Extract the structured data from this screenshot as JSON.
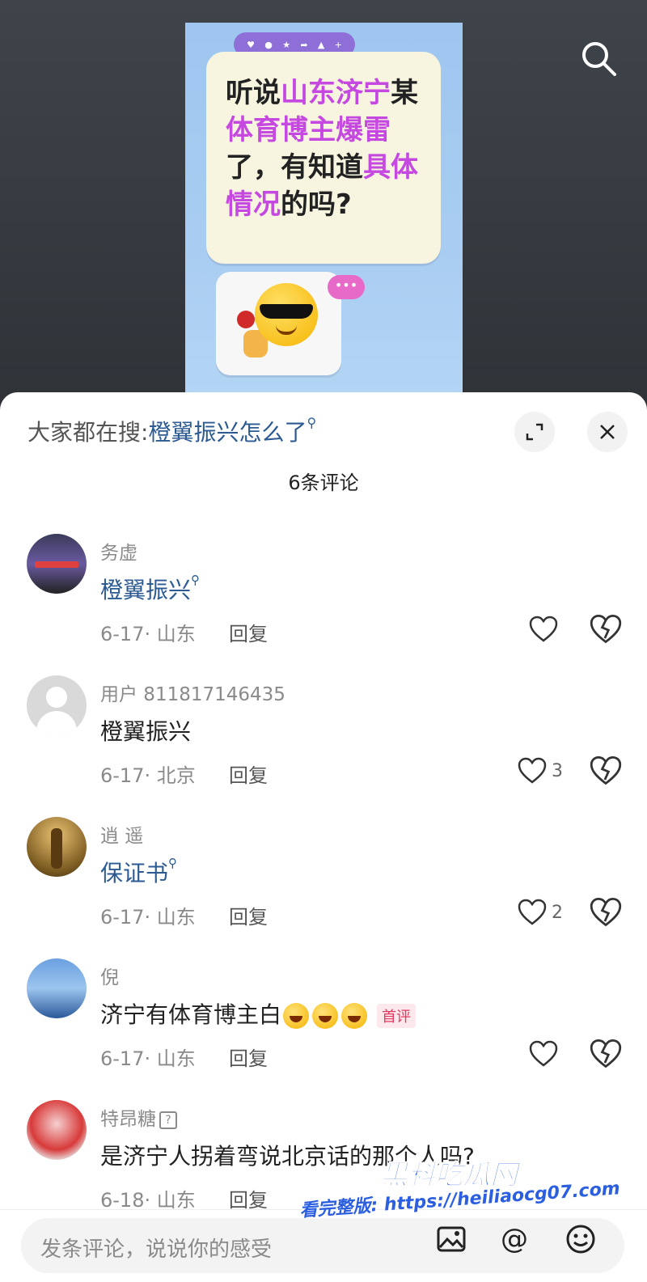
{
  "video": {
    "bubble_parts": [
      {
        "t": "听说",
        "hl": false
      },
      {
        "t": "山东济宁",
        "hl": true
      },
      {
        "t": "某",
        "hl": false
      },
      {
        "t": "体育博主爆雷",
        "hl": true
      },
      {
        "t": "了，有知道",
        "hl": false
      },
      {
        "t": "具体情况",
        "hl": true
      },
      {
        "t": "的吗?",
        "hl": false
      }
    ],
    "accent_color": "#c548e0"
  },
  "sheet": {
    "search_prefix": "大家都在搜:",
    "search_keyword": "橙翼振兴怎么了",
    "comment_count": "6条评论"
  },
  "comments": [
    {
      "user": "务虚",
      "text": "橙翼振兴",
      "link": true,
      "meta": "6-17· 山东",
      "reply": "回复",
      "likes": "",
      "avatar": "city-night"
    },
    {
      "user": "用户 811817146435",
      "text": "橙翼振兴",
      "link": false,
      "meta": "6-17· 北京",
      "reply": "回复",
      "likes": "3",
      "avatar": "default-user"
    },
    {
      "user": "逍 遥",
      "text": "保证书",
      "link": true,
      "meta": "6-17· 山东",
      "reply": "回复",
      "likes": "2",
      "avatar": "warrior"
    },
    {
      "user": "倪",
      "text": "济宁有体育博主白",
      "link": false,
      "meta": "6-17· 山东",
      "reply": "回复",
      "likes": "",
      "avatar": "sky",
      "emojis": 3,
      "badge": "首评"
    },
    {
      "user": "特昂糖",
      "text": "是济宁人拐着弯说北京话的那个人吗?",
      "link": false,
      "meta": "6-18· 山东",
      "reply": "回复",
      "likes": "",
      "avatar": "red-jacket",
      "qbox": "?"
    }
  ],
  "input": {
    "placeholder": "发条评论，说说你的感受"
  },
  "watermark": {
    "title": "黑料吃瓜网",
    "url": "看完整版: https://heiliaocg07.com"
  }
}
